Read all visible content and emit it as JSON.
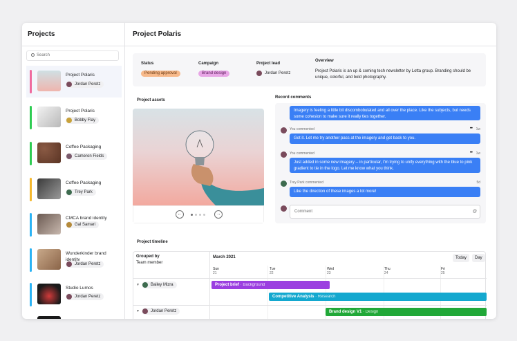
{
  "sidebar": {
    "title": "Projects",
    "search_placeholder": "Search",
    "projects": [
      {
        "name": "Project Polaris",
        "owner": "Jordan Peretz",
        "color": "#f06a9e"
      },
      {
        "name": "Project Polaris",
        "owner": "Bobby Flay",
        "color": "#2ecc52"
      },
      {
        "name": "Coffee Packaging",
        "owner": "Cameron Fields",
        "color": "#2ecc52"
      },
      {
        "name": "Coffee Packaging",
        "owner": "Trey Park",
        "color": "#f5b82e"
      },
      {
        "name": "CMCA brand identity",
        "owner": "Gal Samari",
        "color": "#2bb3f5"
      },
      {
        "name": "Wunderkinder brand identity",
        "owner": "Jordan Peretz",
        "color": "#2bb3f5"
      },
      {
        "name": "Studio Lumos",
        "owner": "Jordan Peretz",
        "color": "#2bb3f5"
      }
    ]
  },
  "main": {
    "title": "Project Polaris",
    "status_label": "Status",
    "status_value": "Pending approval",
    "campaign_label": "Campaign",
    "campaign_value": "Brand design",
    "lead_label": "Project lead",
    "lead_value": "Jordan Peretz",
    "overview_label": "Overview",
    "overview_text": "Project Polaris is an up & coming tech newsletter by Lotta group. Branding should be unique, colorful, and bold photography."
  },
  "assets": {
    "title": "Project assets"
  },
  "comments": {
    "title": "Record comments",
    "items": [
      {
        "meta": "",
        "time": "",
        "text": "Imagery is feeling a little bit discombobulated and all over the place. Like the subjects, but needs some cohesion to make sure it really ties together."
      },
      {
        "meta": "You commented",
        "time": "1w",
        "text": "Got it. Let me try another pass at the imagery and get back to you."
      },
      {
        "meta": "You commented",
        "time": "1w",
        "text": "Just added in some new imagery -- in particular, I'm trying to unify everything with the blue to pink gradient to tie in the logo. Let me know what you think."
      },
      {
        "meta": "Trey Park commented",
        "time": "5d",
        "text": "Like the direction of these images a lot more!"
      }
    ],
    "input_placeholder": "Comment"
  },
  "timeline": {
    "title": "Project timeline",
    "grouped_by": "Grouped by",
    "group_value": "Team member",
    "month": "March 2021",
    "today_btn": "Today",
    "day_btn": "Day",
    "days": [
      {
        "dow": "Sun",
        "num": "21"
      },
      {
        "dow": "Tue",
        "num": "22"
      },
      {
        "dow": "Wed",
        "num": "23"
      },
      {
        "dow": "Thu",
        "num": "24"
      },
      {
        "dow": "Fri",
        "num": "25"
      }
    ],
    "members": [
      "Bailey Mizra",
      "Jordan Peretz"
    ],
    "tasks": [
      {
        "name": "Project brief",
        "tag": "· Background",
        "color": "#9b3fe0"
      },
      {
        "name": "Competitive Analysis",
        "tag": "· Research",
        "color": "#14a8cf"
      },
      {
        "name": "Brand design V1",
        "tag": "· Design",
        "color": "#21a838"
      }
    ]
  }
}
